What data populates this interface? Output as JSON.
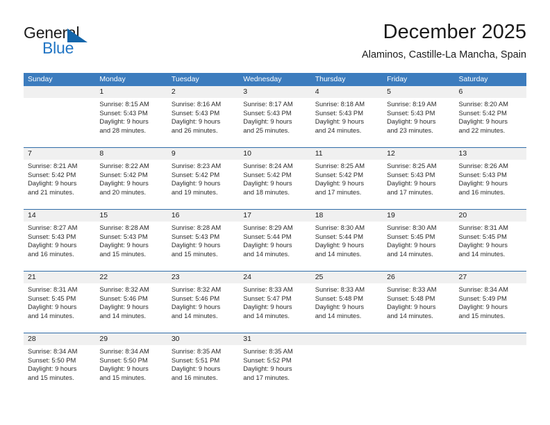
{
  "logo": {
    "word_one": "General",
    "word_two": "Blue",
    "triangle_icon": "triangle-icon",
    "brand_blue": "#2175c4",
    "brand_dark_blue": "#1466ab"
  },
  "header": {
    "title": "December 2025",
    "location": "Alaminos, Castille-La Mancha, Spain"
  },
  "colors": {
    "header_row_bg": "#3c7cbe",
    "week_divider": "#2f6ca8",
    "daynum_band": "#f0f0f0",
    "text": "#1b1b1b"
  },
  "weekdays": [
    "Sunday",
    "Monday",
    "Tuesday",
    "Wednesday",
    "Thursday",
    "Friday",
    "Saturday"
  ],
  "weeks": [
    [
      {
        "day": "",
        "sunrise": "",
        "sunset": "",
        "daylight_line1": "",
        "daylight_line2": ""
      },
      {
        "day": "1",
        "sunrise": "Sunrise: 8:15 AM",
        "sunset": "Sunset: 5:43 PM",
        "daylight_line1": "Daylight: 9 hours",
        "daylight_line2": "and 28 minutes."
      },
      {
        "day": "2",
        "sunrise": "Sunrise: 8:16 AM",
        "sunset": "Sunset: 5:43 PM",
        "daylight_line1": "Daylight: 9 hours",
        "daylight_line2": "and 26 minutes."
      },
      {
        "day": "3",
        "sunrise": "Sunrise: 8:17 AM",
        "sunset": "Sunset: 5:43 PM",
        "daylight_line1": "Daylight: 9 hours",
        "daylight_line2": "and 25 minutes."
      },
      {
        "day": "4",
        "sunrise": "Sunrise: 8:18 AM",
        "sunset": "Sunset: 5:43 PM",
        "daylight_line1": "Daylight: 9 hours",
        "daylight_line2": "and 24 minutes."
      },
      {
        "day": "5",
        "sunrise": "Sunrise: 8:19 AM",
        "sunset": "Sunset: 5:43 PM",
        "daylight_line1": "Daylight: 9 hours",
        "daylight_line2": "and 23 minutes."
      },
      {
        "day": "6",
        "sunrise": "Sunrise: 8:20 AM",
        "sunset": "Sunset: 5:42 PM",
        "daylight_line1": "Daylight: 9 hours",
        "daylight_line2": "and 22 minutes."
      }
    ],
    [
      {
        "day": "7",
        "sunrise": "Sunrise: 8:21 AM",
        "sunset": "Sunset: 5:42 PM",
        "daylight_line1": "Daylight: 9 hours",
        "daylight_line2": "and 21 minutes."
      },
      {
        "day": "8",
        "sunrise": "Sunrise: 8:22 AM",
        "sunset": "Sunset: 5:42 PM",
        "daylight_line1": "Daylight: 9 hours",
        "daylight_line2": "and 20 minutes."
      },
      {
        "day": "9",
        "sunrise": "Sunrise: 8:23 AM",
        "sunset": "Sunset: 5:42 PM",
        "daylight_line1": "Daylight: 9 hours",
        "daylight_line2": "and 19 minutes."
      },
      {
        "day": "10",
        "sunrise": "Sunrise: 8:24 AM",
        "sunset": "Sunset: 5:42 PM",
        "daylight_line1": "Daylight: 9 hours",
        "daylight_line2": "and 18 minutes."
      },
      {
        "day": "11",
        "sunrise": "Sunrise: 8:25 AM",
        "sunset": "Sunset: 5:42 PM",
        "daylight_line1": "Daylight: 9 hours",
        "daylight_line2": "and 17 minutes."
      },
      {
        "day": "12",
        "sunrise": "Sunrise: 8:25 AM",
        "sunset": "Sunset: 5:43 PM",
        "daylight_line1": "Daylight: 9 hours",
        "daylight_line2": "and 17 minutes."
      },
      {
        "day": "13",
        "sunrise": "Sunrise: 8:26 AM",
        "sunset": "Sunset: 5:43 PM",
        "daylight_line1": "Daylight: 9 hours",
        "daylight_line2": "and 16 minutes."
      }
    ],
    [
      {
        "day": "14",
        "sunrise": "Sunrise: 8:27 AM",
        "sunset": "Sunset: 5:43 PM",
        "daylight_line1": "Daylight: 9 hours",
        "daylight_line2": "and 16 minutes."
      },
      {
        "day": "15",
        "sunrise": "Sunrise: 8:28 AM",
        "sunset": "Sunset: 5:43 PM",
        "daylight_line1": "Daylight: 9 hours",
        "daylight_line2": "and 15 minutes."
      },
      {
        "day": "16",
        "sunrise": "Sunrise: 8:28 AM",
        "sunset": "Sunset: 5:43 PM",
        "daylight_line1": "Daylight: 9 hours",
        "daylight_line2": "and 15 minutes."
      },
      {
        "day": "17",
        "sunrise": "Sunrise: 8:29 AM",
        "sunset": "Sunset: 5:44 PM",
        "daylight_line1": "Daylight: 9 hours",
        "daylight_line2": "and 14 minutes."
      },
      {
        "day": "18",
        "sunrise": "Sunrise: 8:30 AM",
        "sunset": "Sunset: 5:44 PM",
        "daylight_line1": "Daylight: 9 hours",
        "daylight_line2": "and 14 minutes."
      },
      {
        "day": "19",
        "sunrise": "Sunrise: 8:30 AM",
        "sunset": "Sunset: 5:45 PM",
        "daylight_line1": "Daylight: 9 hours",
        "daylight_line2": "and 14 minutes."
      },
      {
        "day": "20",
        "sunrise": "Sunrise: 8:31 AM",
        "sunset": "Sunset: 5:45 PM",
        "daylight_line1": "Daylight: 9 hours",
        "daylight_line2": "and 14 minutes."
      }
    ],
    [
      {
        "day": "21",
        "sunrise": "Sunrise: 8:31 AM",
        "sunset": "Sunset: 5:45 PM",
        "daylight_line1": "Daylight: 9 hours",
        "daylight_line2": "and 14 minutes."
      },
      {
        "day": "22",
        "sunrise": "Sunrise: 8:32 AM",
        "sunset": "Sunset: 5:46 PM",
        "daylight_line1": "Daylight: 9 hours",
        "daylight_line2": "and 14 minutes."
      },
      {
        "day": "23",
        "sunrise": "Sunrise: 8:32 AM",
        "sunset": "Sunset: 5:46 PM",
        "daylight_line1": "Daylight: 9 hours",
        "daylight_line2": "and 14 minutes."
      },
      {
        "day": "24",
        "sunrise": "Sunrise: 8:33 AM",
        "sunset": "Sunset: 5:47 PM",
        "daylight_line1": "Daylight: 9 hours",
        "daylight_line2": "and 14 minutes."
      },
      {
        "day": "25",
        "sunrise": "Sunrise: 8:33 AM",
        "sunset": "Sunset: 5:48 PM",
        "daylight_line1": "Daylight: 9 hours",
        "daylight_line2": "and 14 minutes."
      },
      {
        "day": "26",
        "sunrise": "Sunrise: 8:33 AM",
        "sunset": "Sunset: 5:48 PM",
        "daylight_line1": "Daylight: 9 hours",
        "daylight_line2": "and 14 minutes."
      },
      {
        "day": "27",
        "sunrise": "Sunrise: 8:34 AM",
        "sunset": "Sunset: 5:49 PM",
        "daylight_line1": "Daylight: 9 hours",
        "daylight_line2": "and 15 minutes."
      }
    ],
    [
      {
        "day": "28",
        "sunrise": "Sunrise: 8:34 AM",
        "sunset": "Sunset: 5:50 PM",
        "daylight_line1": "Daylight: 9 hours",
        "daylight_line2": "and 15 minutes."
      },
      {
        "day": "29",
        "sunrise": "Sunrise: 8:34 AM",
        "sunset": "Sunset: 5:50 PM",
        "daylight_line1": "Daylight: 9 hours",
        "daylight_line2": "and 15 minutes."
      },
      {
        "day": "30",
        "sunrise": "Sunrise: 8:35 AM",
        "sunset": "Sunset: 5:51 PM",
        "daylight_line1": "Daylight: 9 hours",
        "daylight_line2": "and 16 minutes."
      },
      {
        "day": "31",
        "sunrise": "Sunrise: 8:35 AM",
        "sunset": "Sunset: 5:52 PM",
        "daylight_line1": "Daylight: 9 hours",
        "daylight_line2": "and 17 minutes."
      },
      {
        "day": "",
        "sunrise": "",
        "sunset": "",
        "daylight_line1": "",
        "daylight_line2": ""
      },
      {
        "day": "",
        "sunrise": "",
        "sunset": "",
        "daylight_line1": "",
        "daylight_line2": ""
      },
      {
        "day": "",
        "sunrise": "",
        "sunset": "",
        "daylight_line1": "",
        "daylight_line2": ""
      }
    ]
  ]
}
